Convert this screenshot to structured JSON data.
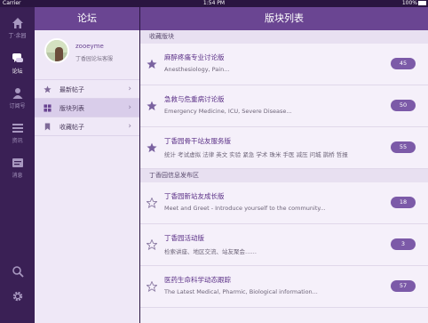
{
  "status_bar": {
    "carrier": "Carrier",
    "time": "1:54 PM",
    "battery": "100%"
  },
  "rail": {
    "items": [
      {
        "label": "丁·余园",
        "icon": "home-icon"
      },
      {
        "label": "论坛",
        "icon": "chat-bubbles-icon"
      },
      {
        "label": "订阅号",
        "icon": "person-icon"
      },
      {
        "label": "资讯",
        "icon": "news-list-icon"
      },
      {
        "label": "消息",
        "icon": "message-icon"
      }
    ],
    "bottom": [
      {
        "icon": "search-icon"
      },
      {
        "icon": "gear-icon"
      }
    ]
  },
  "forum": {
    "title": "论坛",
    "user": {
      "name": "zooeyme",
      "subtitle": "丁香园论坛客服"
    },
    "menu": [
      {
        "label": "最新帖子",
        "icon": "star-icon"
      },
      {
        "label": "版块列表",
        "icon": "grid-icon"
      },
      {
        "label": "收藏帖子",
        "icon": "bookmark-icon"
      }
    ]
  },
  "boards": {
    "title": "版块列表",
    "sections": [
      {
        "title": "收藏版块",
        "items": [
          {
            "title": "麻醉疼痛专业讨论版",
            "desc": "Anesthesiology, Pain...",
            "count": "45",
            "starred": true
          },
          {
            "title": "急救与危重病讨论版",
            "desc": "Emergency Medicine, ICU, Severe Disease...",
            "count": "50",
            "starred": true
          },
          {
            "title": "丁香园骨干站友服务版",
            "desc": "统计 考试虚拟 法律 英文 实验 紧急 学术 珠米 手医 减压 问城 鹊桥 哲报",
            "count": "55",
            "starred": true
          }
        ]
      },
      {
        "title": "丁香园信息发布区",
        "items": [
          {
            "title": "丁香园新站友成长版",
            "desc": "Meet and Greet - Introduce yourself to the community...",
            "count": "18",
            "starred": false
          },
          {
            "title": "丁香园活动版",
            "desc": "检索讲座、地区交流、站友聚会……",
            "count": "3",
            "starred": false
          },
          {
            "title": "医药生命科学动态跟踪",
            "desc": "The Latest Medical, Pharmic, Biological information...",
            "count": "57",
            "starred": false
          }
        ]
      }
    ]
  },
  "colors": {
    "header": "#6a4592",
    "rail": "#3a2055",
    "badge": "#7c5aa8",
    "title_text": "#5a2f86"
  }
}
